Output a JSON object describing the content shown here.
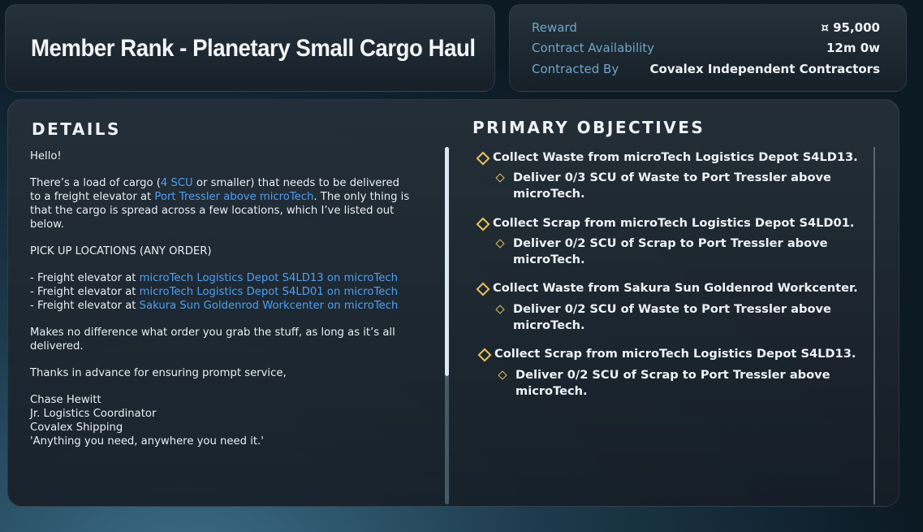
{
  "title": "Member Rank - Planetary Small Cargo Haul",
  "info": [
    {
      "label": "Reward",
      "value": "¤ 95,000"
    },
    {
      "label": "Contract Availability",
      "value": "12m 0w"
    },
    {
      "label": "Contracted By",
      "value": "Covalex Independent Contractors"
    }
  ],
  "details": {
    "heading": "DETAILS",
    "greeting": "Hello!",
    "p1_a": "There’s a load of cargo (",
    "p1_hl1": "4 SCU",
    "p1_b": " or smaller) that needs to be delivered to a freight elevator at ",
    "p1_hl2": "Port Tressler above microTech",
    "p1_c": ". The only thing is that the cargo is spread across a few locations, which I’ve listed out below.",
    "pickup_heading": "PICK UP LOCATIONS (ANY ORDER)",
    "locations": [
      {
        "prefix": "- Freight elevator at ",
        "place": "microTech Logistics Depot S4LD13 on microTech"
      },
      {
        "prefix": "- Freight elevator at ",
        "place": "microTech Logistics Depot S4LD01 on microTech"
      },
      {
        "prefix": "- Freight elevator at ",
        "place": "Sakura Sun Goldenrod Workcenter on microTech"
      }
    ],
    "p2": "Makes no difference what order you grab the stuff, as long as it’s all delivered.",
    "p3": "Thanks in advance for ensuring prompt service,",
    "sig_name": "Chase Hewitt",
    "sig_role": "Jr. Logistics Coordinator",
    "sig_company": "Covalex Shipping",
    "sig_motto": "'Anything you need, anywhere you need it.'"
  },
  "objectives": {
    "heading": "PRIMARY OBJECTIVES",
    "items": [
      {
        "main": "Collect Waste from microTech Logistics Depot S4LD13.",
        "sub": "Deliver 0/3 SCU of Waste to Port Tressler above microTech."
      },
      {
        "main": "Collect Scrap from microTech Logistics Depot S4LD01.",
        "sub": "Deliver 0/2 SCU of Scrap to Port Tressler above microTech."
      },
      {
        "main": "Collect Waste from Sakura Sun Goldenrod Workcenter.",
        "sub": "Deliver 0/2 SCU of Waste to Port Tressler above microTech."
      },
      {
        "main": "Collect Scrap from microTech Logistics Depot S4LD13.",
        "sub": "Deliver 0/2 SCU of Scrap to Port Tressler above microTech."
      }
    ]
  },
  "colors": {
    "accent": "#4f9ff0",
    "label": "#6ea6c9",
    "diamond": "#e8c25a"
  }
}
